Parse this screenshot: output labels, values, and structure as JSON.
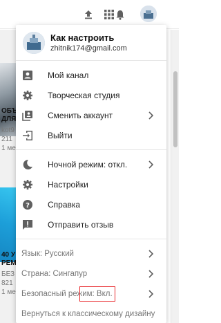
{
  "feed": {
    "card1_title_1": "ОБЪ",
    "card1_title_2": "ДЛЯ",
    "card1_channel": "kot9",
    "card1_views": "211",
    "card1_age": "1 ме",
    "card2_title_1": "40 У",
    "card2_title_2": "РЕМ",
    "card2_channel": "БЕЗ",
    "card2_views": "821",
    "card2_age": "1 ме"
  },
  "account": {
    "name": "Как настроить",
    "email": "zhitnik174@gmail.com"
  },
  "menu": {
    "section1": [
      {
        "label": "Мой канал",
        "icon": "account-box-icon",
        "chevron": false
      },
      {
        "label": "Творческая студия",
        "icon": "gear-icon",
        "chevron": false
      },
      {
        "label": "Сменить аккаунт",
        "icon": "switch-account-icon",
        "chevron": true
      },
      {
        "label": "Выйти",
        "icon": "sign-out-icon",
        "chevron": false
      }
    ],
    "section2": [
      {
        "label": "Ночной режим: откл.",
        "icon": "moon-icon",
        "chevron": true
      },
      {
        "label": "Настройки",
        "icon": "gear-icon",
        "chevron": false
      },
      {
        "label": "Справка",
        "icon": "help-icon",
        "chevron": false
      },
      {
        "label": "Отправить отзыв",
        "icon": "feedback-icon",
        "chevron": false
      }
    ],
    "section3": [
      {
        "label": "Язык: Русский",
        "chevron": true
      },
      {
        "label": "Страна: Сингапур",
        "chevron": true
      },
      {
        "label": "Безопасный режим: Вкл.",
        "chevron": true
      },
      {
        "label": "Вернуться к классическому дизайну",
        "chevron": false
      }
    ]
  },
  "colors": {
    "highlight": "#e8262a",
    "icon": "#606060"
  }
}
